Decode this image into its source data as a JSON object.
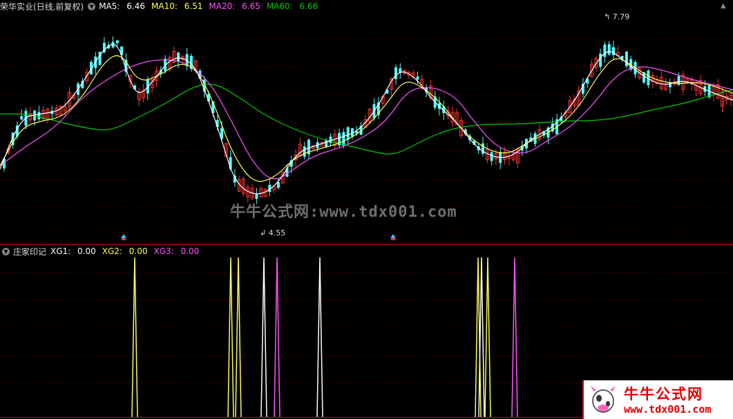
{
  "colors": {
    "ma5": "#ffffff",
    "ma10": "#ffff55",
    "ma20": "#ff55ff",
    "ma60": "#00cc00",
    "up": "#ff3333",
    "down": "#54ffff",
    "xg1": "#ffffff",
    "xg2": "#ffff55",
    "xg3": "#ff55ff"
  },
  "main_panel": {
    "stock_name": "荣华实业",
    "period": "(日线,前复权)",
    "settings_icon": "gear-circle-icon",
    "ma5_label": "MA5:",
    "ma5_value": "6.46",
    "ma10_label": "MA10:",
    "ma10_value": "6.51",
    "ma20_label": "MA20:",
    "ma20_value": "6.65",
    "ma60_label": "MA60:",
    "ma60_value": "6.66",
    "high_marker": "7.79",
    "low_marker": "4.55",
    "collapse_icon": "chevron-up-icon"
  },
  "indicator_panel": {
    "name": "庄家印记",
    "xg1_label": "XG1:",
    "xg1_value": "0.00",
    "xg2_label": "XG2:",
    "xg2_value": "0.00",
    "xg3_label": "XG3:",
    "xg3_value": "0.00"
  },
  "watermark": "牛牛公式网:www.tdx001.com",
  "logo": {
    "title": "牛牛公式网",
    "url": "www.tdx001.com"
  },
  "chart_data": {
    "type": "candlestick",
    "price_range": [
      4.55,
      7.79
    ],
    "ma_series": [
      "MA5",
      "MA10",
      "MA20",
      "MA60"
    ],
    "indicator_signals": {
      "XG1": [],
      "XG2": [],
      "XG3": []
    }
  }
}
